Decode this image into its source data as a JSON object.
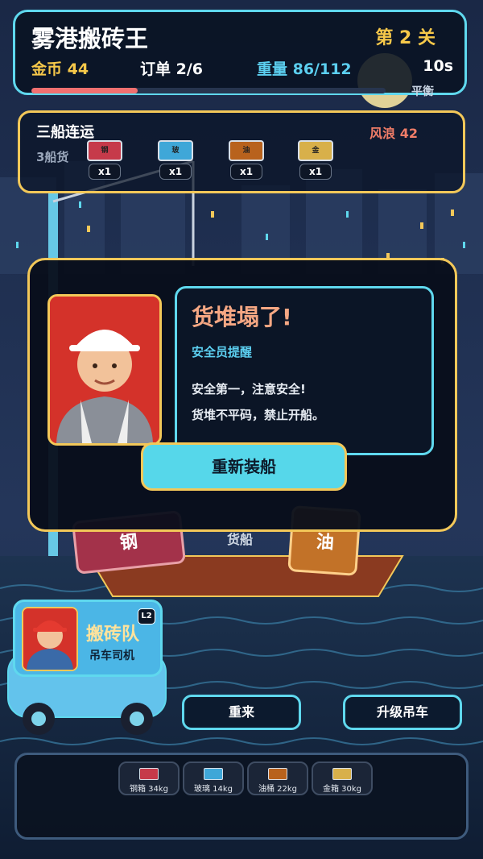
{
  "hud": {
    "title": "雾港搬砖王",
    "level": "第 2 关",
    "gold": "金币 44",
    "orders": "订单 2/6",
    "weight": "重量 86/112",
    "timer": "10s",
    "balance_label": "平衡",
    "progress_fraction": 0.3
  },
  "combo": {
    "title": "三船连运",
    "wind": "风浪 42",
    "cargo_label": "3船货",
    "items": [
      {
        "chip": "钢",
        "qty": "x1",
        "color": "#c63a4a"
      },
      {
        "chip": "玻",
        "qty": "x1",
        "color": "#3fa7d8"
      },
      {
        "chip": "油",
        "qty": "x1",
        "color": "#b8621d"
      },
      {
        "chip": "金",
        "qty": "x1",
        "color": "#d8b04a"
      }
    ]
  },
  "ship": {
    "cargo_steel": "钢",
    "cargo_oil": "油",
    "hull_label": "货船"
  },
  "dialog": {
    "title": "货堆塌了!",
    "speaker": "安全员提醒",
    "line1": "安全第一，注意安全!",
    "line2": "货堆不平码，禁止开船。",
    "button": "重新装船"
  },
  "team": {
    "name": "搬砖队",
    "role": "吊车司机",
    "level": "L2"
  },
  "buttons": {
    "retry": "重来",
    "upgrade": "升级吊车"
  },
  "inventory": {
    "items": [
      {
        "label": "钢箱 34kg",
        "color": "#c63a4a"
      },
      {
        "label": "玻璃 14kg",
        "color": "#3fa7d8"
      },
      {
        "label": "油桶 22kg",
        "color": "#b8621d"
      },
      {
        "label": "金箱 30kg",
        "color": "#d8b04a"
      }
    ]
  }
}
